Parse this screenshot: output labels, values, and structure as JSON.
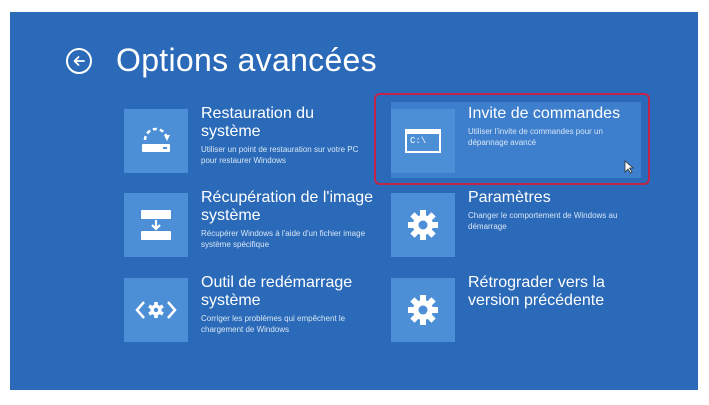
{
  "screen": {
    "title": "Options avancées",
    "accent": "#2a6ab8",
    "tile_color": "#4c8fd6",
    "highlight_color": "#c4234a"
  },
  "tiles": [
    {
      "name": "Restauration du système",
      "desc": "Utiliser un point de restauration sur votre PC pour restaurer Windows",
      "icon": "system-restore-icon"
    },
    {
      "name": "Invite de commandes",
      "desc": "Utiliser l'invite de commandes pour un dépannage avancé",
      "icon": "command-prompt-icon",
      "icon_text": "C:\\",
      "selected": true
    },
    {
      "name": "Récupération de l'image système",
      "desc": "Récupérer Windows à l'aide d'un fichier image système spécifique",
      "icon": "system-image-icon"
    },
    {
      "name": "Paramètres",
      "desc": "Changer le comportement de Windows au démarrage",
      "icon": "gear-icon"
    },
    {
      "name": "Outil de redémarrage système",
      "desc": "Corriger les problèmes qui empêchent le chargement de Windows",
      "icon": "startup-repair-icon"
    },
    {
      "name": "Rétrograder vers la version précédente",
      "desc": "",
      "icon": "gear-icon"
    }
  ]
}
